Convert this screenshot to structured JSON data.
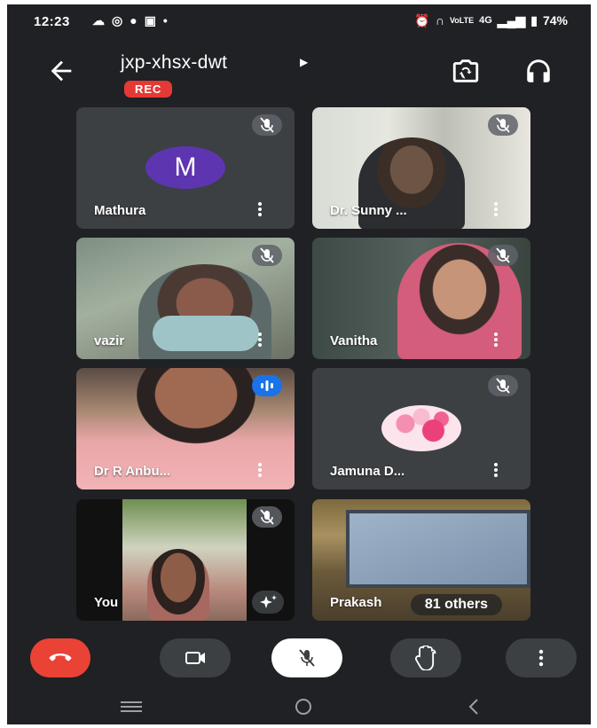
{
  "status_bar": {
    "time": "12:23",
    "battery": "74%",
    "network": "4G"
  },
  "meeting": {
    "title": "jxp-xhsx-dwt",
    "recording_label": "REC"
  },
  "participants": [
    {
      "name": "Mathura",
      "avatar_letter": "M",
      "muted": true
    },
    {
      "name": "Dr. Sunny ...",
      "muted": true
    },
    {
      "name": "vazir",
      "muted": true
    },
    {
      "name": "Vanitha",
      "muted": true
    },
    {
      "name": "Dr R Anbu...",
      "muted": false,
      "speaking": true
    },
    {
      "name": "Jamuna D...",
      "muted": true
    },
    {
      "name": "You",
      "muted": true
    },
    {
      "name": "Prakash",
      "others_label": "81 others"
    }
  ],
  "colors": {
    "background": "#202124",
    "tile": "#3c4043",
    "end_call": "#ea4335",
    "rec": "#e53935",
    "speaking": "#1a73e8",
    "avatar_m": "#5e35b1"
  },
  "icons": [
    "back-arrow-icon",
    "switch-camera-icon",
    "headphones-icon",
    "mic-off-icon",
    "more-vert-icon",
    "end-call-icon",
    "camera-icon",
    "raise-hand-icon",
    "effects-icon"
  ]
}
